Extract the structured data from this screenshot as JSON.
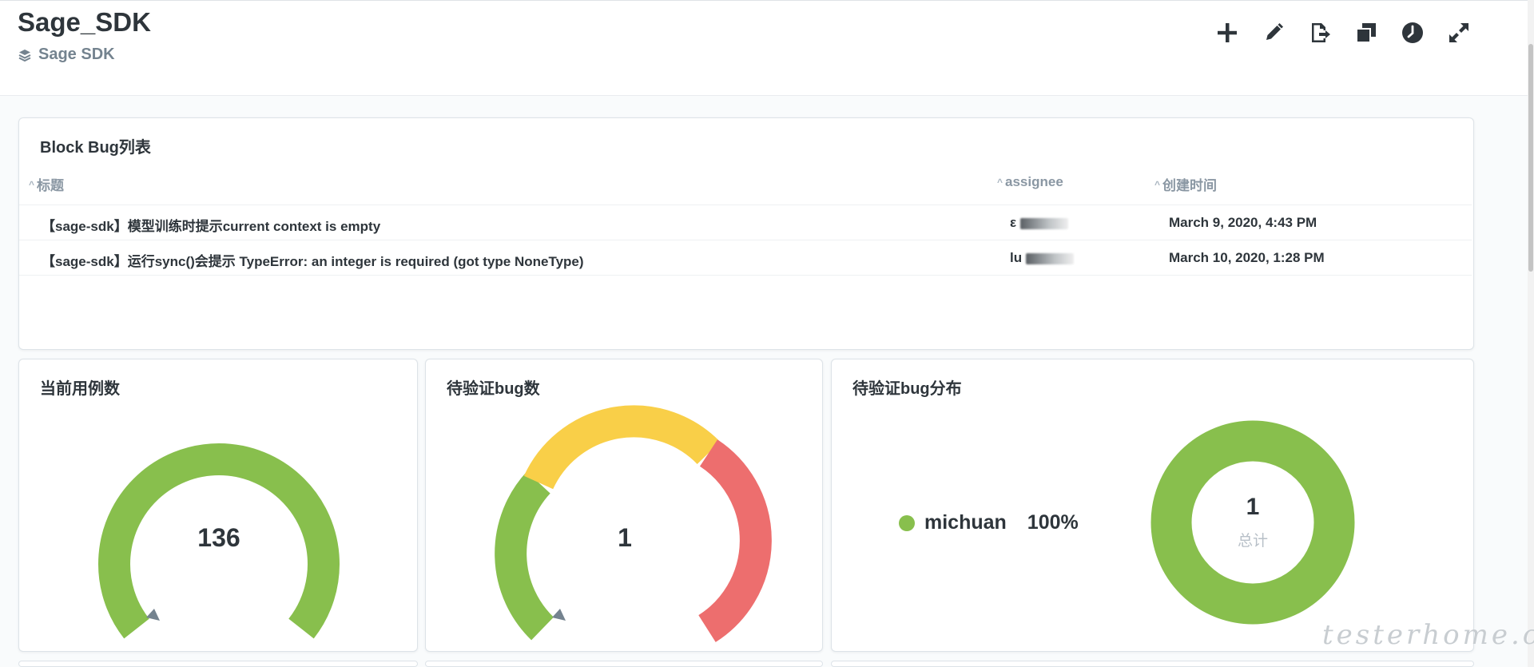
{
  "header": {
    "title": "Sage_SDK",
    "collection": "Sage SDK",
    "toolbar": [
      "add-icon",
      "edit-icon",
      "export-icon",
      "duplicate-icon",
      "history-icon",
      "fullscreen-icon"
    ]
  },
  "table_card": {
    "title": "Block Bug列表",
    "columns": [
      "标题",
      "assignee",
      "创建时间"
    ],
    "rows": [
      {
        "title": "【sage-sdk】模型训练时提示current context is empty",
        "assignee": "ε",
        "created": "March 9, 2020, 4:43 PM"
      },
      {
        "title": "【sage-sdk】运行sync()会提示 TypeError: an integer is required (got type NoneType)",
        "assignee": "lu",
        "created": "March 10, 2020, 1:28 PM"
      }
    ]
  },
  "case_count": {
    "title": "当前用例数",
    "value": "136",
    "color": "#88bf4d"
  },
  "pending_bugs": {
    "title": "待验证bug数",
    "value": "1",
    "colors": [
      "#88bf4d",
      "#f9cf48",
      "#ed6e6e"
    ]
  },
  "bug_distribution": {
    "title": "待验证bug分布",
    "legend": [
      {
        "name": "michuan",
        "percent": "100%",
        "color": "#88bf4d"
      }
    ],
    "total_value": "1",
    "total_label": "总计"
  },
  "watermark": "testerhome.com"
}
